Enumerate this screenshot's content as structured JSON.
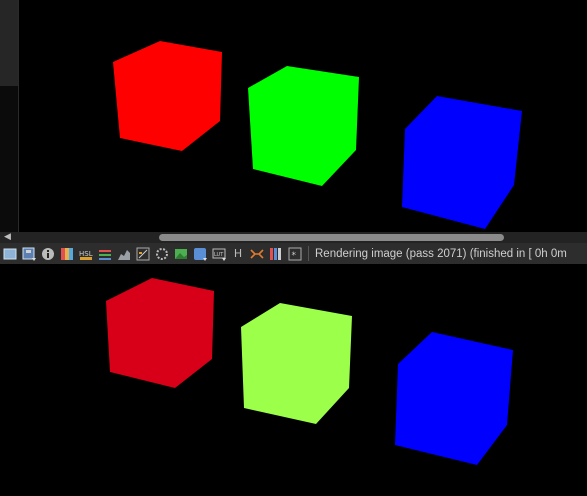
{
  "status_bar": {
    "text": "Rendering image (pass 2071) (finished in [ 0h  0m"
  },
  "toolbar_icons": [
    "save-image-icon",
    "save-all-icon",
    "info-icon",
    "color-correction-icon",
    "hsl-icon",
    "levels-icon",
    "curves-icon",
    "histogram-icon",
    "lut-icon",
    "background-icon",
    "layer-icon",
    "lut-file-icon",
    "history-icon",
    "compare-ab-icon",
    "channel-icon",
    "stamp-icon"
  ],
  "scene_top": {
    "cube_colors": {
      "red": "#ff0000",
      "green": "#00ff00",
      "blue": "#0000ff"
    }
  },
  "scene_bottom": {
    "cube_colors": {
      "red": "#d80018",
      "green": "#9cff4a",
      "blue": "#0000ff"
    }
  }
}
